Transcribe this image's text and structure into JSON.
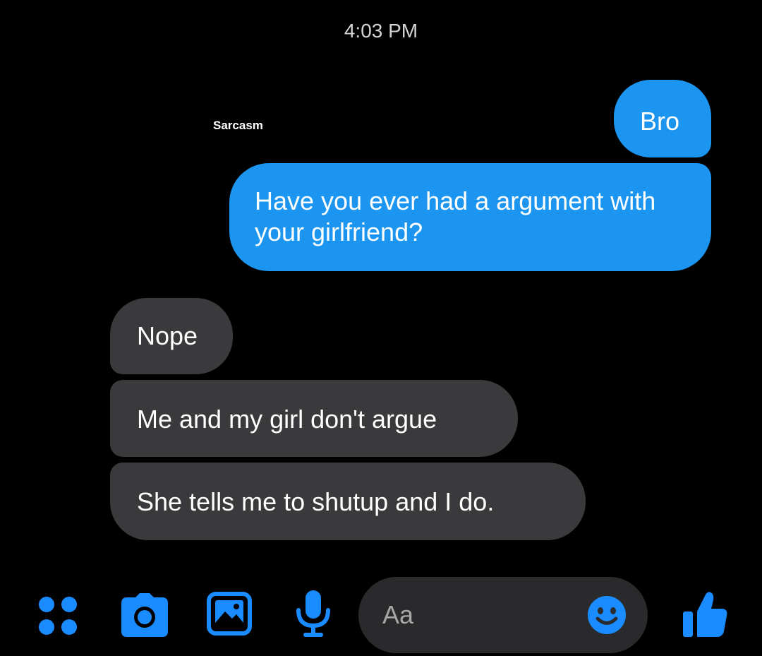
{
  "header": {
    "time": "4:03 PM"
  },
  "watermark": "Sarcasm",
  "messages": [
    {
      "direction": "outgoing",
      "text": "Bro"
    },
    {
      "direction": "outgoing",
      "text": "Have you ever had a argument with your girlfriend?"
    },
    {
      "direction": "incoming",
      "text": "Nope"
    },
    {
      "direction": "incoming",
      "text": "Me and my girl don't argue"
    },
    {
      "direction": "incoming",
      "text": "She tells me to shutup and I do."
    }
  ],
  "composer": {
    "placeholder": "Aa"
  },
  "toolbar": {
    "icons": [
      "menu-dots-icon",
      "camera-icon",
      "gallery-icon",
      "microphone-icon",
      "emoji-icon",
      "thumbs-up-icon"
    ]
  },
  "colors": {
    "background": "#000000",
    "outgoing_bubble": "#1b95ef",
    "incoming_bubble": "#3a3a3c",
    "accent_icon": "#1a8cff",
    "composer_bg": "#2a2a2c"
  }
}
